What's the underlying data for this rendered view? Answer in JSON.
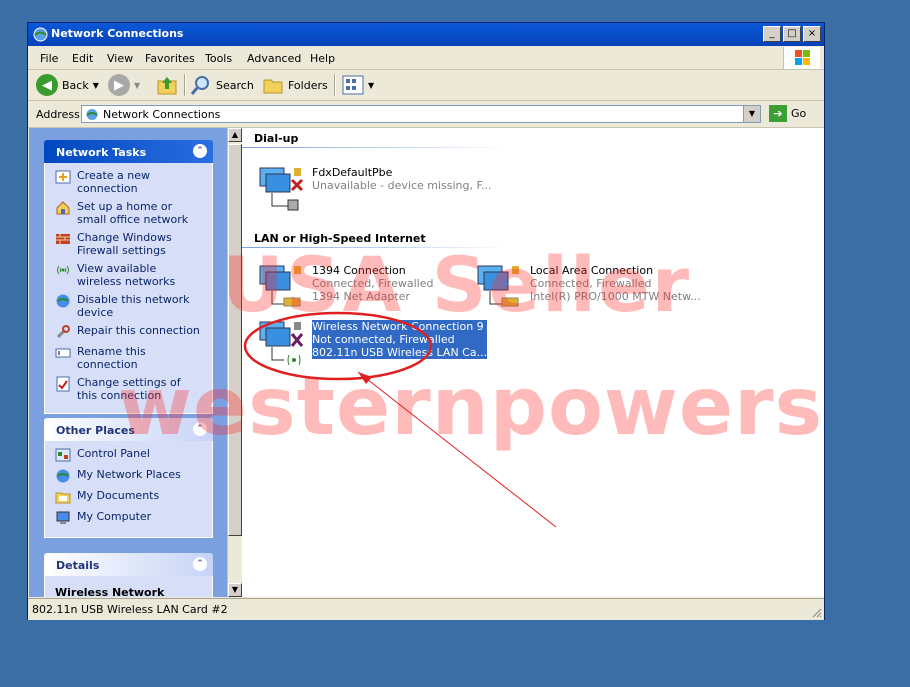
{
  "window": {
    "title": "Network Connections",
    "buttons": [
      "_",
      "□",
      "×"
    ]
  },
  "menu": {
    "items": [
      "File",
      "Edit",
      "View",
      "Favorites",
      "Tools",
      "Advanced",
      "Help"
    ]
  },
  "toolbar": {
    "back": "Back",
    "search": "Search",
    "folders": "Folders"
  },
  "address": {
    "label": "Address",
    "value": "Network Connections",
    "go": "Go"
  },
  "left_pane": {
    "network_tasks": {
      "title": "Network Tasks",
      "items": [
        {
          "label": "Create a new connection",
          "icon": "new-connection-icon"
        },
        {
          "label": "Set up a home or small office network",
          "icon": "home-network-icon"
        },
        {
          "label": "Change Windows Firewall settings",
          "icon": "firewall-icon"
        },
        {
          "label": "View available wireless networks",
          "icon": "wireless-icon"
        },
        {
          "label": "Disable this network device",
          "icon": "disable-icon"
        },
        {
          "label": "Repair this connection",
          "icon": "repair-icon"
        },
        {
          "label": "Rename this connection",
          "icon": "rename-icon"
        },
        {
          "label": "Change settings of this connection",
          "icon": "settings-icon"
        }
      ]
    },
    "other_places": {
      "title": "Other Places",
      "items": [
        {
          "label": "Control Panel",
          "icon": "control-panel-icon"
        },
        {
          "label": "My Network Places",
          "icon": "network-places-icon"
        },
        {
          "label": "My Documents",
          "icon": "documents-icon"
        },
        {
          "label": "My Computer",
          "icon": "computer-icon"
        }
      ]
    },
    "details": {
      "title": "Details",
      "text": "Wireless Network"
    }
  },
  "groups": {
    "dialup": "Dial-up",
    "lan": "LAN or High-Speed Internet"
  },
  "connections": [
    {
      "name": "FdxDefaultPbe",
      "status": "Unavailable - device missing, F..."
    },
    {
      "name": "1394 Connection",
      "status": "Connected, Firewalled",
      "device": "1394 Net Adapter"
    },
    {
      "name": "Local Area Connection",
      "status": "Connected, Firewalled",
      "device": "Intel(R) PRO/1000 MTW Netw..."
    },
    {
      "name": "Wireless Network Connection 9",
      "status": "Not connected, Firewalled",
      "device": "802.11n USB Wireless LAN Ca..."
    }
  ],
  "statusbar": {
    "text": "802.11n USB Wireless LAN Card #2"
  },
  "watermark": {
    "line1": "USA Seller",
    "line2": "westernpowers"
  },
  "colors": {
    "desktop": "#3a6ea5",
    "titlebar": "#0a58d8",
    "selection": "#316ac5",
    "annotation": "#e02020"
  }
}
